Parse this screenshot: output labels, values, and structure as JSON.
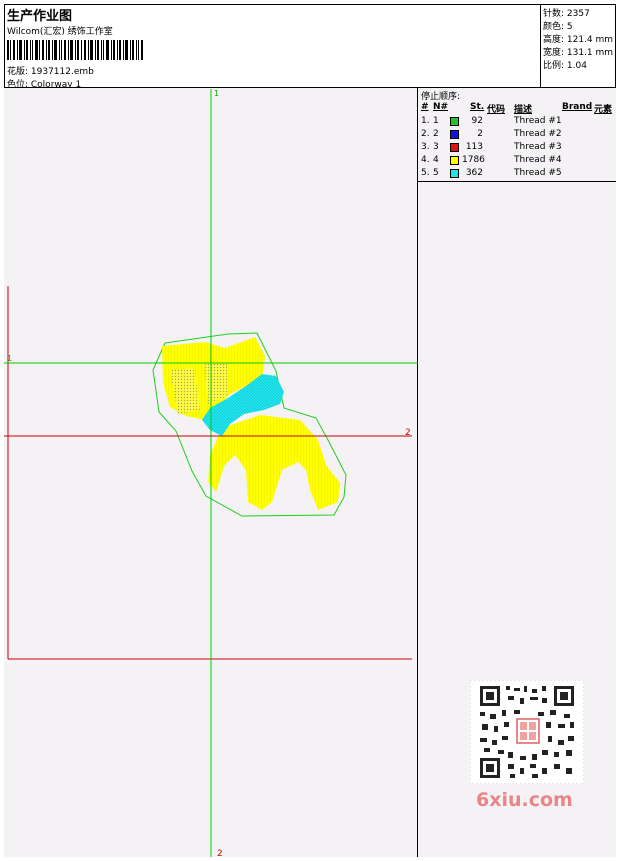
{
  "header": {
    "title": "生产作业图",
    "subtitle": "Wilcom(汇宏) 绣饰工作室",
    "design_line": "花版:  1937112.emb",
    "colorway_line": "色位:  Colorway 1"
  },
  "stats": {
    "stitches": "针数: 2357",
    "colors": "颜色: 5",
    "height": "高度: 121.4 mm",
    "width": "宽度: 131.1 mm",
    "scale": "比例: 1.04"
  },
  "stop_sequence": {
    "title": "停止顺序:",
    "headers": {
      "idx": "#",
      "needle": "N#",
      "stitches": "St.",
      "code": "代码",
      "desc": "描述",
      "brand": "Brand",
      "element": "元素"
    },
    "rows": [
      {
        "idx": "1.",
        "needle": "1",
        "color": "#22c32a",
        "stitches": "92",
        "desc": "Thread #1"
      },
      {
        "idx": "2.",
        "needle": "2",
        "color": "#1010e0",
        "stitches": "2",
        "desc": "Thread #2"
      },
      {
        "idx": "3.",
        "needle": "3",
        "color": "#e51010",
        "stitches": "113",
        "desc": "Thread #3"
      },
      {
        "idx": "4.",
        "needle": "4",
        "color": "#ffff00",
        "stitches": "1786",
        "desc": "Thread #4"
      },
      {
        "idx": "5.",
        "needle": "5",
        "color": "#22e5e5",
        "stitches": "362",
        "desc": "Thread #5"
      }
    ]
  },
  "canvas": {
    "green_v_label": "1",
    "green_v_label_bottom": "2",
    "green_h_label": "1",
    "red_h_label": "2",
    "guide_green": "#00cc00",
    "guide_red": "#cc0000",
    "outline_green": "#22cc22"
  },
  "watermark": {
    "text": "6xiu.com"
  }
}
